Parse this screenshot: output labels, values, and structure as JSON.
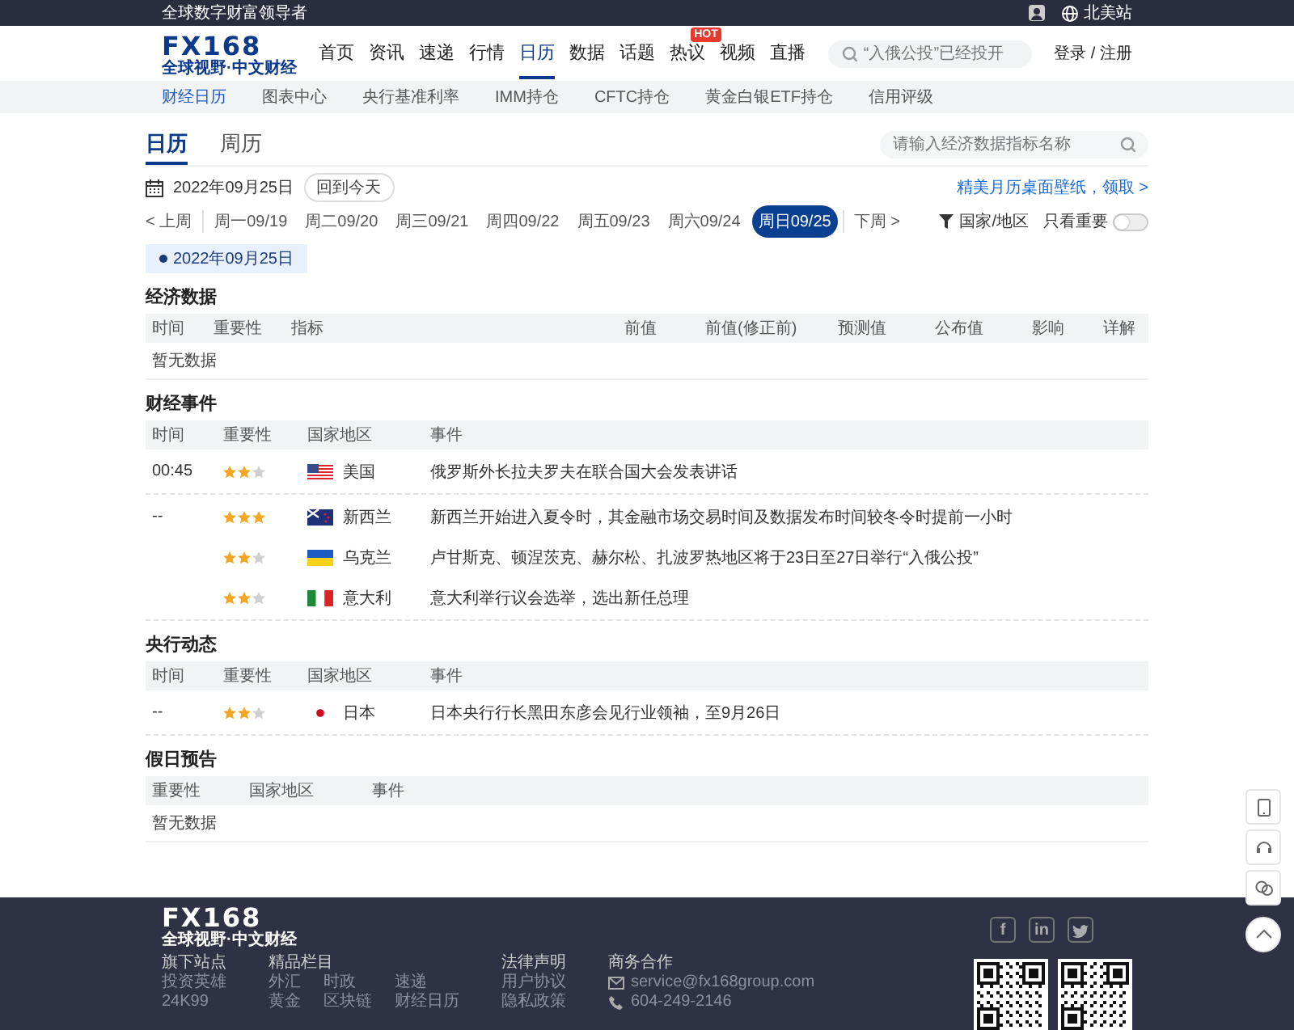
{
  "top_bar": {
    "slogan": "全球数字财富领导者",
    "region": "北美站"
  },
  "header": {
    "logo": "FX168",
    "logo_tagline": "全球视野·中文财经",
    "nav": [
      {
        "label": "首页",
        "selected": false
      },
      {
        "label": "资讯",
        "selected": false
      },
      {
        "label": "速递",
        "selected": false
      },
      {
        "label": "行情",
        "selected": false
      },
      {
        "label": "日历",
        "selected": true
      },
      {
        "label": "数据",
        "selected": false
      },
      {
        "label": "话题",
        "selected": false
      },
      {
        "label": "热议",
        "selected": false,
        "badge": "HOT"
      },
      {
        "label": "视频",
        "selected": false
      },
      {
        "label": "直播",
        "selected": false
      }
    ],
    "search": {
      "placeholder": "“入俄公投”已经投开"
    },
    "account": "登录 / 注册"
  },
  "subnav": [
    {
      "label": "财经日历",
      "selected": true
    },
    {
      "label": "图表中心",
      "selected": false
    },
    {
      "label": "央行基准利率",
      "selected": false
    },
    {
      "label": "IMM持仓",
      "selected": false
    },
    {
      "label": "CFTC持仓",
      "selected": false
    },
    {
      "label": "黄金白银ETF持仓",
      "selected": false
    },
    {
      "label": "信用评级",
      "selected": false
    }
  ],
  "calendar": {
    "tabs": [
      {
        "label": "日历",
        "selected": true
      },
      {
        "label": "周历",
        "selected": false
      }
    ],
    "search": {
      "placeholder": "请输入经济数据指标名称"
    },
    "date": "2022年09月25日",
    "today_button": "回到今天",
    "promo_link": "精美月历桌面壁纸，领取 >",
    "prev_week": "< 上周",
    "days": [
      {
        "label": "周一09/19",
        "selected": false
      },
      {
        "label": "周二09/20",
        "selected": false
      },
      {
        "label": "周三09/21",
        "selected": false
      },
      {
        "label": "周四09/22",
        "selected": false
      },
      {
        "label": "周五09/23",
        "selected": false
      },
      {
        "label": "周六09/24",
        "selected": false
      },
      {
        "label": "周日09/25",
        "selected": true
      }
    ],
    "next_week": "下周 >",
    "region_filter": "国家/地区",
    "important_only": {
      "label": "只看重要",
      "on": false
    },
    "date_chip": "2022年09月25日"
  },
  "sections": [
    {
      "title": "经济数据",
      "kind": "data",
      "columns": [
        "时间",
        "重要性",
        "指标",
        "前值",
        "前值(修正前)",
        "预测值",
        "公布值",
        "影响",
        "详解"
      ],
      "empty": "暂无数据"
    },
    {
      "title": "财经事件",
      "kind": "events",
      "columns": [
        "时间",
        "重要性",
        "国家地区",
        "事件"
      ],
      "groups": [
        {
          "time": "00:45",
          "items": [
            {
              "stars": 2,
              "kind": "us",
              "country": "美国",
              "event": "俄罗斯外长拉夫罗夫在联合国大会发表讲话"
            }
          ]
        },
        {
          "time": "--",
          "items": [
            {
              "stars": 3,
              "kind": "nz",
              "country": "新西兰",
              "event": "新西兰开始进入夏令时，其金融市场交易时间及数据发布时间较冬令时提前一小时"
            },
            {
              "stars": 2,
              "kind": "ua",
              "country": "乌克兰",
              "event": "卢甘斯克、顿涅茨克、赫尔松、扎波罗热地区将于23日至27日举行“入俄公投”"
            },
            {
              "stars": 2,
              "kind": "it",
              "country": "意大利",
              "event": "意大利举行议会选举，选出新任总理"
            }
          ]
        }
      ]
    },
    {
      "title": "央行动态",
      "kind": "events",
      "columns": [
        "时间",
        "重要性",
        "国家地区",
        "事件"
      ],
      "groups": [
        {
          "time": "--",
          "items": [
            {
              "stars": 2,
              "kind": "jp",
              "country": "日本",
              "event": "日本央行行长黑田东彦会见行业领袖，至9月26日"
            }
          ]
        }
      ]
    },
    {
      "title": "假日预告",
      "kind": "holidays",
      "columns": [
        "重要性",
        "国家地区",
        "事件"
      ],
      "empty": "暂无数据"
    }
  ],
  "footer": {
    "logo": "FX168",
    "logo_tagline": "全球视野·中文财经",
    "columns": [
      {
        "title": "旗下站点",
        "links": [
          "投资英雄",
          "24K99"
        ]
      },
      {
        "title": "精品栏目",
        "links": [
          "外汇",
          "时政",
          "速递",
          "黄金",
          "区块链",
          "财经日历"
        ]
      },
      {
        "title": "法律声明",
        "links": [
          "用户协议",
          "隐私政策"
        ]
      },
      {
        "title": "商务合作",
        "contacts": [
          {
            "kind": "email",
            "text": "service@fx168group.com"
          },
          {
            "kind": "phone",
            "text": "604-249-2146"
          }
        ]
      }
    ],
    "social": [
      {
        "kind": "facebook",
        "label": "f"
      },
      {
        "kind": "linkedin",
        "label": "in"
      },
      {
        "kind": "twitter"
      }
    ]
  }
}
